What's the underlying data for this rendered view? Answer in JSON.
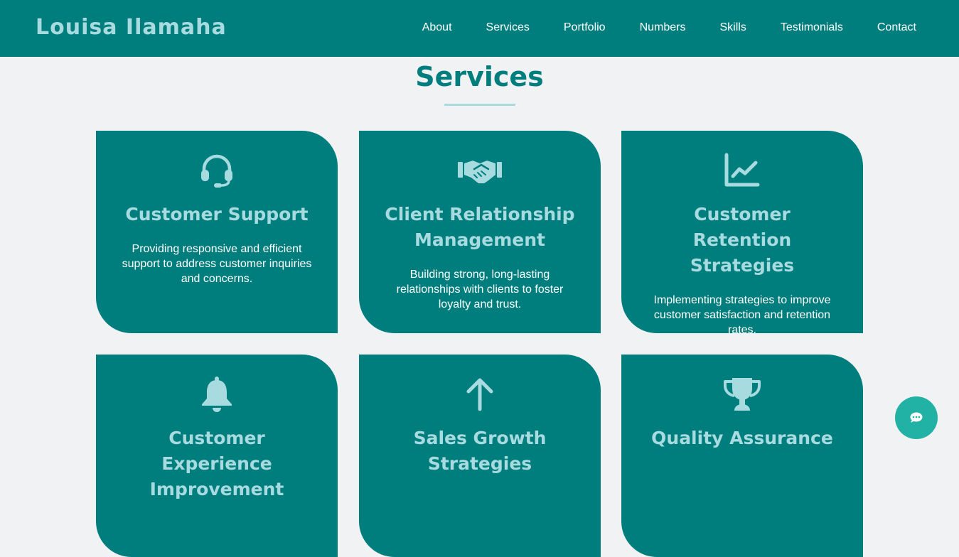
{
  "brand": "Louisa Ilamaha",
  "nav": {
    "items": [
      "About",
      "Services",
      "Portfolio",
      "Numbers",
      "Skills",
      "Testimonials",
      "Contact"
    ]
  },
  "services": {
    "title": "Services",
    "cards": [
      {
        "icon": "headset-icon",
        "title": "Customer Support",
        "text": "Providing responsive and efficient support to address customer inquiries and concerns."
      },
      {
        "icon": "handshake-icon",
        "title": "Client Relationship Management",
        "text": "Building strong, long-lasting relationships with clients to foster loyalty and trust."
      },
      {
        "icon": "chart-line-icon",
        "title": "Customer Retention Strategies",
        "text": "Implementing strategies to improve customer satisfaction and retention rates."
      },
      {
        "icon": "bell-icon",
        "title": "Customer Experience Improvement",
        "text": ""
      },
      {
        "icon": "arrow-up-icon",
        "title": "Sales Growth Strategies",
        "text": ""
      },
      {
        "icon": "trophy-icon",
        "title": "Quality Assurance",
        "text": ""
      }
    ]
  },
  "chat": {
    "icon": "chat-bubble-icon"
  },
  "colors": {
    "primary": "#007e7e",
    "accent": "#a8dbe0",
    "background": "#f1f2f4",
    "chat_button": "#21b1a5"
  }
}
